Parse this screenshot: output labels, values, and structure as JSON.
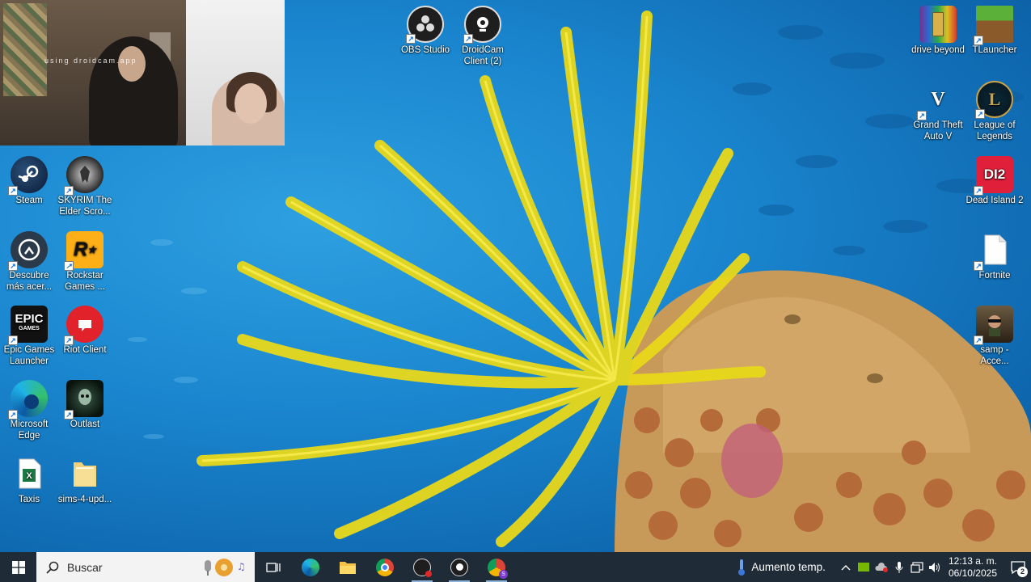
{
  "webcam": {
    "watermark": "using droidcam.app"
  },
  "desktop": {
    "left_icons": [
      {
        "name": "steam",
        "label": "Steam"
      },
      {
        "name": "skyrim",
        "label": "SKYRIM The Elder Scro..."
      },
      {
        "name": "descubre",
        "label": "Descubre más acer..."
      },
      {
        "name": "rockstar",
        "label": "Rockstar Games ..."
      },
      {
        "name": "epic",
        "label": "Epic Games Launcher"
      },
      {
        "name": "riot",
        "label": "Riot Client"
      },
      {
        "name": "edge",
        "label": "Microsoft Edge"
      },
      {
        "name": "outlast",
        "label": "Outlast"
      },
      {
        "name": "taxis",
        "label": "Taxis"
      },
      {
        "name": "sims",
        "label": "sims-4-upd..."
      }
    ],
    "top_icons": [
      {
        "name": "obs",
        "label": "OBS Studio"
      },
      {
        "name": "droidcam",
        "label": "DroidCam Client (2)"
      }
    ],
    "right_icons": [
      {
        "name": "drive-beyond",
        "label": "drive beyond"
      },
      {
        "name": "tlauncher",
        "label": "TLauncher"
      },
      {
        "name": "gta",
        "label": "Grand Theft Auto V"
      },
      {
        "name": "lol",
        "label": "League of Legends"
      },
      {
        "name": "dead-island",
        "label": "Dead Island 2"
      },
      {
        "name": "fortnite",
        "label": "Fortnite"
      },
      {
        "name": "samp",
        "label": "samp - Acce..."
      }
    ]
  },
  "taskbar": {
    "search_placeholder": "Buscar",
    "weather_text": "Aumento temp.",
    "time": "12:13 a. m.",
    "date": "06/10/2025",
    "notification_count": "2"
  },
  "colors": {
    "taskbar_bg": "#1f2b36",
    "search_bg": "#f3f3f3",
    "wallpaper_blue": "#1a86cf",
    "crinoid_yellow": "#f2e21a",
    "coral": "#c89a5a"
  }
}
